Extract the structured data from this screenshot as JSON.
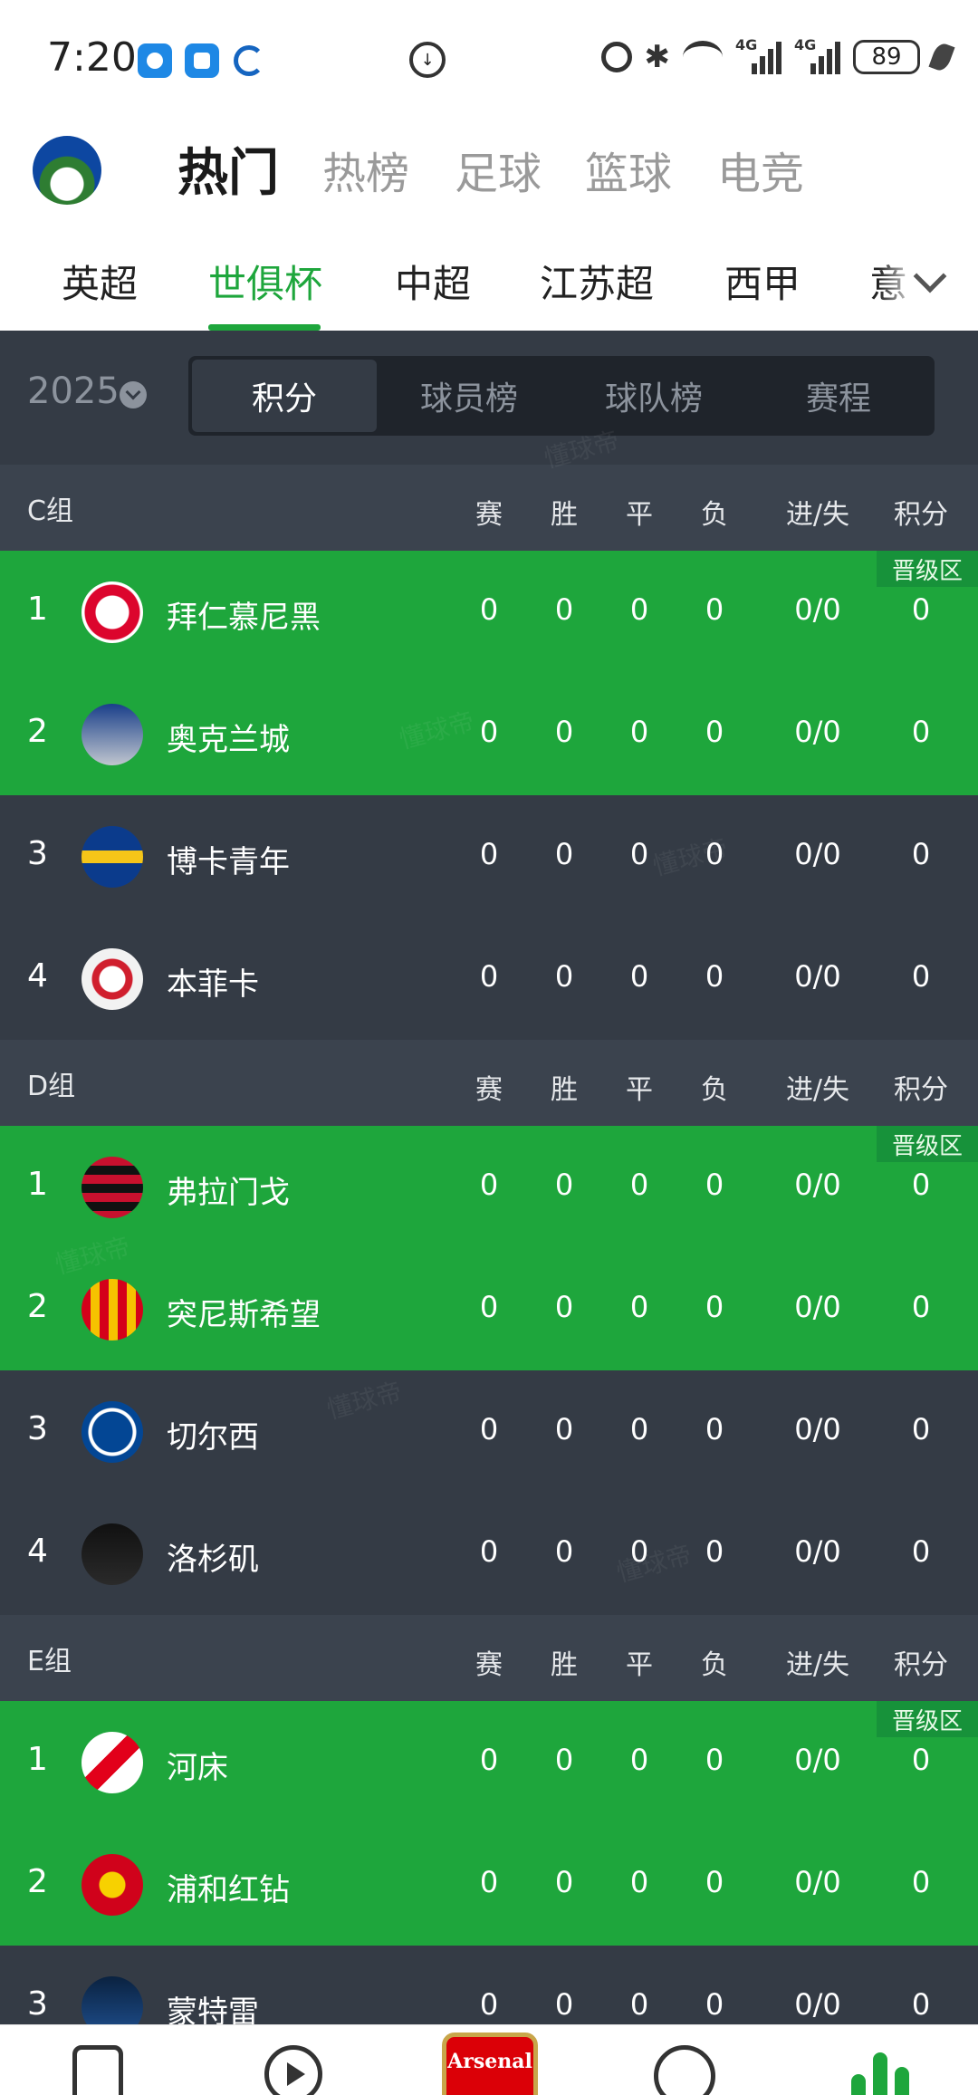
{
  "status_bar": {
    "time": "7:20",
    "network_1": "4G",
    "network_2": "4G",
    "battery": "89",
    "icons": [
      "chat-app-icon",
      "shield-app-icon",
      "sync-icon",
      "data-saver-icon",
      "alarm-icon",
      "bluetooth-icon",
      "wifi-icon",
      "signal-icon",
      "battery-icon",
      "leaf-icon"
    ]
  },
  "header": {
    "tabs": [
      "热门",
      "热榜",
      "足球",
      "篮球",
      "电竞"
    ],
    "active_tab": "热门"
  },
  "leagues": {
    "items": [
      "英超",
      "世俱杯",
      "中超",
      "江苏超",
      "西甲",
      "意"
    ],
    "active": "世俱杯",
    "accent_color": "#1ea63c"
  },
  "season": {
    "year": "2025"
  },
  "segments": {
    "items": [
      "积分",
      "球员榜",
      "球队榜",
      "赛程"
    ],
    "active": "积分"
  },
  "columns": [
    "赛",
    "胜",
    "平",
    "负",
    "进/失",
    "积分"
  ],
  "advance_label": "晋级区",
  "groups": [
    {
      "name": "C组",
      "teams": [
        {
          "rank": "1",
          "name": "拜仁慕尼黑",
          "logo": "bayern-logo-icon",
          "p": "0",
          "w": "0",
          "d": "0",
          "l": "0",
          "gf": "0/0",
          "pts": "0",
          "advance": true
        },
        {
          "rank": "2",
          "name": "奥克兰城",
          "logo": "auckland-city-logo-icon",
          "p": "0",
          "w": "0",
          "d": "0",
          "l": "0",
          "gf": "0/0",
          "pts": "0",
          "advance": true
        },
        {
          "rank": "3",
          "name": "博卡青年",
          "logo": "boca-juniors-logo-icon",
          "p": "0",
          "w": "0",
          "d": "0",
          "l": "0",
          "gf": "0/0",
          "pts": "0",
          "advance": false
        },
        {
          "rank": "4",
          "name": "本菲卡",
          "logo": "benfica-logo-icon",
          "p": "0",
          "w": "0",
          "d": "0",
          "l": "0",
          "gf": "0/0",
          "pts": "0",
          "advance": false
        }
      ]
    },
    {
      "name": "D组",
      "teams": [
        {
          "rank": "1",
          "name": "弗拉门戈",
          "logo": "flamengo-logo-icon",
          "p": "0",
          "w": "0",
          "d": "0",
          "l": "0",
          "gf": "0/0",
          "pts": "0",
          "advance": true
        },
        {
          "rank": "2",
          "name": "突尼斯希望",
          "logo": "esperance-logo-icon",
          "p": "0",
          "w": "0",
          "d": "0",
          "l": "0",
          "gf": "0/0",
          "pts": "0",
          "advance": true
        },
        {
          "rank": "3",
          "name": "切尔西",
          "logo": "chelsea-logo-icon",
          "p": "0",
          "w": "0",
          "d": "0",
          "l": "0",
          "gf": "0/0",
          "pts": "0",
          "advance": false
        },
        {
          "rank": "4",
          "name": "洛杉矶",
          "logo": "lafc-logo-icon",
          "p": "0",
          "w": "0",
          "d": "0",
          "l": "0",
          "gf": "0/0",
          "pts": "0",
          "advance": false
        }
      ]
    },
    {
      "name": "E组",
      "teams": [
        {
          "rank": "1",
          "name": "河床",
          "logo": "river-plate-logo-icon",
          "p": "0",
          "w": "0",
          "d": "0",
          "l": "0",
          "gf": "0/0",
          "pts": "0",
          "advance": true
        },
        {
          "rank": "2",
          "name": "浦和红钻",
          "logo": "urawa-logo-icon",
          "p": "0",
          "w": "0",
          "d": "0",
          "l": "0",
          "gf": "0/0",
          "pts": "0",
          "advance": true
        },
        {
          "rank": "3",
          "name": "蒙特雷",
          "logo": "monterrey-logo-icon",
          "p": "0",
          "w": "0",
          "d": "0",
          "l": "0",
          "gf": "0/0",
          "pts": "0",
          "advance": false
        }
      ]
    }
  ],
  "bottom_nav": {
    "items": [
      "news-icon",
      "video-icon",
      "arsenal-logo-icon",
      "ball-icon",
      "data-icon"
    ],
    "center_badge_text": "Arsenal",
    "active": "data-icon"
  },
  "colors": {
    "dark_bg": "#343b45",
    "group_head_bg": "#3b434e",
    "advance_green": "#1ea63c"
  }
}
